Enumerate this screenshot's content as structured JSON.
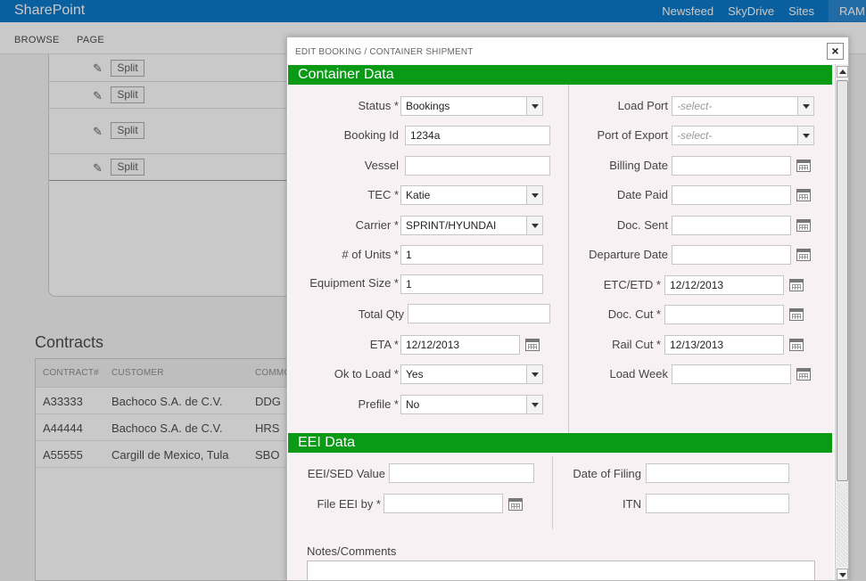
{
  "suitebar": {
    "brand": "SharePoint",
    "links": [
      "Newsfeed",
      "SkyDrive",
      "Sites"
    ],
    "user": "RAM"
  },
  "ribbon": {
    "browse": "BROWSE",
    "page": "PAGE"
  },
  "splits": {
    "label": "Split",
    "rows": [
      "Split",
      "Split",
      "Split",
      "Split"
    ]
  },
  "contracts": {
    "title": "Contracts",
    "headers": [
      "CONTRACT#",
      "CUSTOMER",
      "COMMO"
    ],
    "rows": [
      [
        "A33333",
        "Bachoco S.A. de C.V.",
        "DDG"
      ],
      [
        "A44444",
        "Bachoco S.A. de C.V.",
        "HRS"
      ],
      [
        "A55555",
        "Cargill de Mexico, Tula",
        "SBO"
      ]
    ]
  },
  "dialog": {
    "title": "EDIT BOOKING / CONTAINER SHIPMENT",
    "close": "×",
    "container_section": "Container Data",
    "eei_section": "EEI Data",
    "left": {
      "status": {
        "label": "Status *",
        "value": "Bookings"
      },
      "booking_id": {
        "label": "Booking Id",
        "value": "1234a"
      },
      "vessel": {
        "label": "Vessel",
        "value": ""
      },
      "tec": {
        "label": "TEC *",
        "value": "Katie"
      },
      "carrier": {
        "label": "Carrier *",
        "value": "SPRINT/HYUNDAI"
      },
      "units": {
        "label": "# of Units *",
        "value": "1"
      },
      "equipment": {
        "label": "Equipment Size *",
        "value": "1"
      },
      "total_qty": {
        "label": "Total Qty",
        "value": ""
      },
      "eta": {
        "label": "ETA *",
        "value": "12/12/2013"
      },
      "ok_to_load": {
        "label": "Ok to Load *",
        "value": "Yes"
      },
      "prefile": {
        "label": "Prefile *",
        "value": "No"
      }
    },
    "right": {
      "load_port": {
        "label": "Load Port",
        "placeholder": "-select-"
      },
      "port_export": {
        "label": "Port of Export",
        "placeholder": "-select-"
      },
      "billing_date": {
        "label": "Billing Date",
        "value": ""
      },
      "date_paid": {
        "label": "Date Paid",
        "value": ""
      },
      "doc_sent": {
        "label": "Doc. Sent",
        "value": ""
      },
      "departure": {
        "label": "Departure Date",
        "value": ""
      },
      "etc_etd": {
        "label": "ETC/ETD *",
        "value": "12/12/2013"
      },
      "doc_cut": {
        "label": "Doc. Cut *",
        "value": ""
      },
      "rail_cut": {
        "label": "Rail Cut *",
        "value": "12/13/2013"
      },
      "load_week": {
        "label": "Load Week",
        "value": ""
      }
    },
    "eei": {
      "value": {
        "label": "EEI/SED Value",
        "value": ""
      },
      "file_by": {
        "label": "File EEI by *",
        "value": ""
      },
      "date_filing": {
        "label": "Date of Filing",
        "value": ""
      },
      "itn": {
        "label": "ITN",
        "value": ""
      }
    },
    "notes_label": "Notes/Comments"
  }
}
